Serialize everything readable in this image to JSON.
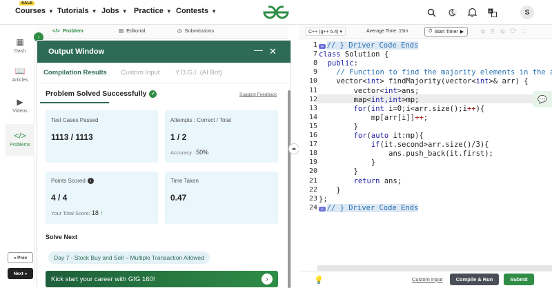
{
  "topnav": {
    "sale_badge": "SALE",
    "items": [
      {
        "label": "Courses"
      },
      {
        "label": "Tutorials"
      },
      {
        "label": "Jobs"
      },
      {
        "label": "Practice"
      },
      {
        "label": "Contests"
      }
    ],
    "logo_text": "GfG",
    "avatar_letter": "S",
    "icons": [
      "search-icon",
      "dark-mode-icon",
      "bell-icon",
      "translate-icon"
    ]
  },
  "rail": {
    "items": [
      {
        "label": "Dash",
        "icon": "grid-icon"
      },
      {
        "label": "Articles",
        "icon": "book-icon"
      },
      {
        "label": "Videos",
        "icon": "play-icon"
      },
      {
        "label": "Problems",
        "icon": "code-icon",
        "active": true
      }
    ],
    "prev_label": "« Prev",
    "next_label": "Next »"
  },
  "problem_tabs": [
    {
      "label": "Problem",
      "active": true
    },
    {
      "label": "Editorial"
    },
    {
      "label": "Submissions"
    }
  ],
  "output_window": {
    "title": "Output Window",
    "tabs": [
      {
        "label": "Compilation Results",
        "active": true
      },
      {
        "label": "Custom Input"
      },
      {
        "label": "Y.O.G.I. (AI Bot)"
      }
    ],
    "status": "Problem Solved Successfully",
    "suggest_feedback": "Suggest Feedback",
    "cards": {
      "test_cases": {
        "label": "Test Cases Passed",
        "value": "1113 / 1113"
      },
      "attempts": {
        "label": "Attempts : Correct / Total",
        "value": "1 / 2",
        "accuracy_label": "Accuracy :",
        "accuracy_value": "50%"
      },
      "points": {
        "label": "Points Scored",
        "value": "4 / 4",
        "total_label": "Your Total Score:",
        "total_value": "18"
      },
      "time": {
        "label": "Time Taken",
        "value": "0.47"
      }
    },
    "solve_next_heading": "Solve Next",
    "solve_next_item": "Day 7 - Stock Buy and Sell – Multiple Transaction Allowed",
    "banner_text": "Kick start your career with GfG 160!",
    "colors": {
      "header": "#2e6b57",
      "accent": "#2f8d46",
      "card": "#e9f6fb"
    }
  },
  "editor": {
    "language": "C++ (g++ 5.4)",
    "average_time": "Average Time: 15m",
    "timer_button": "Start Timer",
    "lines": [
      {
        "n": "1",
        "code": "// } Driver Code Ends",
        "fold": true,
        "sel": true
      },
      {
        "n": "7",
        "code": "class Solution {"
      },
      {
        "n": "8",
        "code": "  public:"
      },
      {
        "n": "9",
        "code": "    // Function to find the majority elements in the array"
      },
      {
        "n": "10",
        "code": "    vector<int> findMajority(vector<int>& arr) {"
      },
      {
        "n": "11",
        "code": "        vector<int>ans;"
      },
      {
        "n": "12",
        "code": "        map<int,int>mp;",
        "current": true
      },
      {
        "n": "13",
        "code": "        for(int i=0;i<arr.size();i++){"
      },
      {
        "n": "14",
        "code": "            mp[arr[i]]++;"
      },
      {
        "n": "15",
        "code": "        }"
      },
      {
        "n": "16",
        "code": "        for(auto it:mp){"
      },
      {
        "n": "17",
        "code": "            if(it.second>arr.size()/3){"
      },
      {
        "n": "18",
        "code": "                ans.push_back(it.first);"
      },
      {
        "n": "19",
        "code": "            }"
      },
      {
        "n": "20",
        "code": "        }"
      },
      {
        "n": "21",
        "code": "        return ans;"
      },
      {
        "n": "22",
        "code": "    }"
      },
      {
        "n": "23",
        "code": "};"
      },
      {
        "n": "24",
        "code": "// } Driver Code Ends",
        "fold": true,
        "sel": true
      }
    ],
    "custom_input_label": "Custom Input",
    "compile_label": "Compile & Run",
    "submit_label": "Submit"
  }
}
